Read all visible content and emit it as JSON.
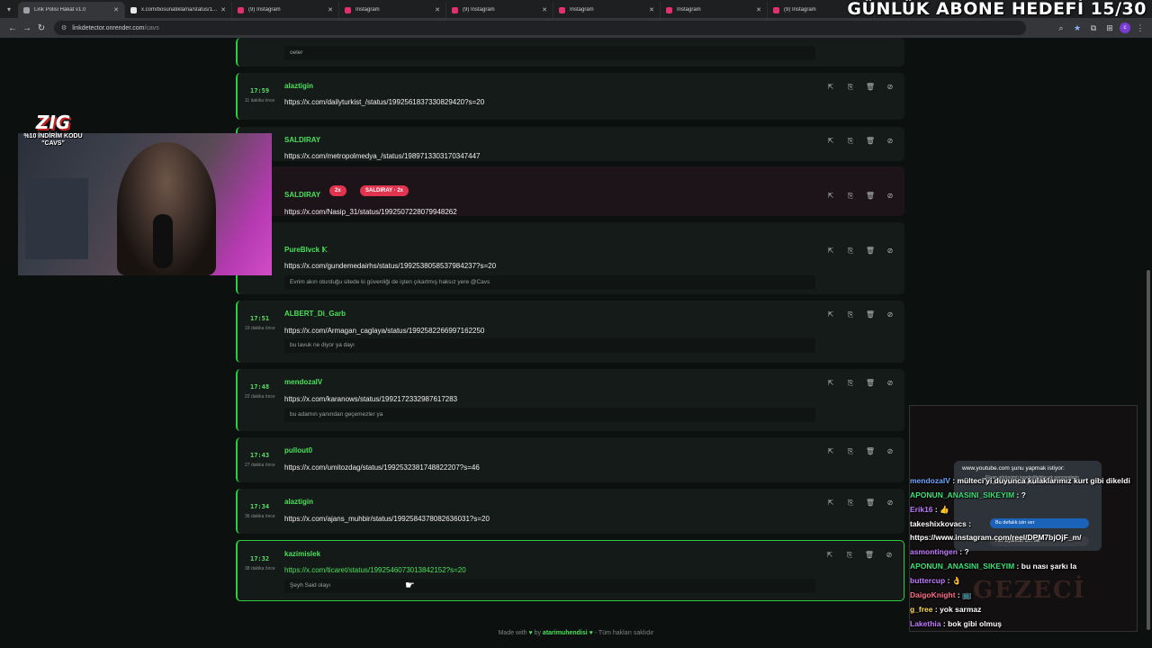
{
  "browser": {
    "tabs": [
      {
        "title": "Link Polisi Hakat v1.0",
        "active": true,
        "favicon_color": "#9aa0a6"
      },
      {
        "title": "x.com/bosunatiklama/status/1...",
        "active": false,
        "favicon_color": "#e8e8e8"
      },
      {
        "title": "(9) Instagram",
        "active": false,
        "favicon_color": "#e1306c"
      },
      {
        "title": "Instagram",
        "active": false,
        "favicon_color": "#e1306c"
      },
      {
        "title": "(9) Instagram",
        "active": false,
        "favicon_color": "#e1306c"
      },
      {
        "title": "Instagram",
        "active": false,
        "favicon_color": "#e1306c"
      },
      {
        "title": "Instagram",
        "active": false,
        "favicon_color": "#e1306c"
      },
      {
        "title": "(9) Instagram",
        "active": false,
        "favicon_color": "#e1306c"
      }
    ],
    "url_host": "linkdetector.onrender.com",
    "url_path": "/cavs",
    "profile_initial": "c"
  },
  "overlay": {
    "goal_text": "GÜNLÜK ABONE HEDEFİ 15/30",
    "promo_logo": "ZIG",
    "promo_code": "%10 İNDİRİM KODU \"CAVS\""
  },
  "entries": [
    {
      "time": "",
      "ago": "",
      "user": "",
      "url": "",
      "note": "oeler",
      "variant": "normal"
    },
    {
      "time": "17:59",
      "ago": "11 dakika önce",
      "user": "alaztigin",
      "url": "https://x.com/dailyturkist_/status/1992561837330829420?s=20",
      "note": "",
      "variant": "normal"
    },
    {
      "time": "",
      "ago": "",
      "user": "SALDIRAY",
      "url": "https://x.com/metropolmedya_/status/1989713303170347447",
      "note": "",
      "variant": "normal"
    },
    {
      "time": "",
      "ago": "",
      "user": "SALDIRAY",
      "url": "https://x.com/Nasip_31/status/1992507228079948262",
      "note": "",
      "variant": "danger",
      "badges": [
        "2x",
        "SALDIRAY · 2x"
      ]
    },
    {
      "time": "",
      "ago": "",
      "user": "PureBlvck 𝕂",
      "url": "https://x.com/gundemedairhs/status/1992538058537984237?s=20",
      "note": "Evrim akın oturduğu sitede ki güvenliği de işten çıkartmış haksız yere @Cavs",
      "variant": "normal"
    },
    {
      "time": "17:51",
      "ago": "19 dakika önce",
      "user": "ALBERT_Di_Garb",
      "url": "https://x.com/Armagan_caglaya/status/1992582266997162250",
      "note": "bu lavuk ne diyor ya dayı",
      "variant": "normal"
    },
    {
      "time": "17:48",
      "ago": "22 dakika önce",
      "user": "mendozaIV",
      "url": "https://x.com/karanows/status/1992172332987617283",
      "note": "bu adamın yanından geçemezler ya",
      "variant": "normal"
    },
    {
      "time": "17:43",
      "ago": "27 dakika önce",
      "user": "pullout0",
      "url": "https://x.com/umitozdag/status/1992532381748822207?s=46",
      "note": "",
      "variant": "normal"
    },
    {
      "time": "17:34",
      "ago": "36 dakika önce",
      "user": "alaztigin",
      "url": "https://x.com/ajans_muhbir/status/1992584378082636031?s=20",
      "note": "",
      "variant": "normal"
    },
    {
      "time": "17:32",
      "ago": "38 dakika önce",
      "user": "kazimislek",
      "url": "https://x.com/ticaret/status/1992546073013842152?s=20",
      "note": "Şeyh Said olayı",
      "variant": "highlight"
    }
  ],
  "footer": {
    "made_with": "Made with",
    "by": "by",
    "author": "atarimuhendisi",
    "rights": "- Tüm hakları saklıdır"
  },
  "chat": {
    "bg_text": "GEZECİ",
    "popup_title": "www.youtube.com şunu yapmak istiyor:",
    "popup_desc": "Ekran görünümü kaydedilebilecek pencerelerin üstünde kullanılabilirsiniz",
    "popup_allow_once": "Bu defalık izin ver",
    "popup_allow_always": "Her ziyarette izin ver",
    "messages": [
      {
        "user": "mendozaIV",
        "text": "mülteci'yi duyunca kulaklarımız kurt gibi dikeldi",
        "color": "#6ea8ff"
      },
      {
        "user": "APONUN_ANASINI_SIKEYIM",
        "text": "?",
        "color": "#3ee07a"
      },
      {
        "user": "Erik16",
        "text": "👍",
        "color": "#c07cff"
      },
      {
        "user": "takeshixkovacs",
        "text": "",
        "color": "#ffffff"
      },
      {
        "user": "",
        "text": "https://www.instagram.com/reel/DPM7bjOjF_m/",
        "color": "#ffffff"
      },
      {
        "user": "asmontingen",
        "text": "?",
        "color": "#c07cff"
      },
      {
        "user": "APONUN_ANASINI_SIKEYIM",
        "text": "bu nası şarkı la",
        "color": "#3ee07a"
      },
      {
        "user": "buttercup",
        "text": "👌",
        "color": "#c07cff"
      },
      {
        "user": "DaigoKnight",
        "text": "📺",
        "color": "#ff6f8a"
      },
      {
        "user": "g_free",
        "text": "yok sarmaz",
        "color": "#ffdc5c"
      },
      {
        "user": "Lakethia",
        "text": "bok gibi olmuş",
        "color": "#c07cff"
      }
    ]
  },
  "colors": {
    "accent": "#2ecc40",
    "danger": "#e03a5a",
    "background": "#0c100e"
  }
}
